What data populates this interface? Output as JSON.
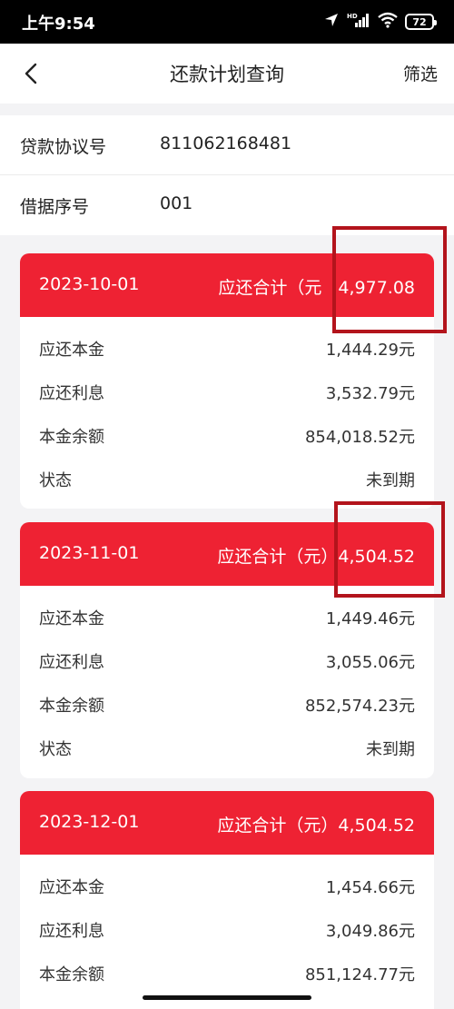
{
  "status_bar": {
    "time": "上午9:54",
    "network": "HD",
    "battery": "72"
  },
  "nav": {
    "title": "还款计划查询",
    "filter_label": "筛选",
    "back_icon": "chevron-left-icon"
  },
  "loan_info": {
    "agreement_label": "贷款协议号",
    "agreement_value": "811062168481",
    "receipt_label": "借据序号",
    "receipt_value": "001"
  },
  "plans": [
    {
      "date": "2023-10-01",
      "total_label": "应还合计（元",
      "total_value": "4,977.08",
      "rows": [
        {
          "label": "应还本金",
          "value": "1,444.29元"
        },
        {
          "label": "应还利息",
          "value": "3,532.79元"
        },
        {
          "label": "本金余额",
          "value": "854,018.52元"
        },
        {
          "label": "状态",
          "value": "未到期"
        }
      ]
    },
    {
      "date": "2023-11-01",
      "total_label": "应还合计（元）",
      "total_value": "4,504.52",
      "rows": [
        {
          "label": "应还本金",
          "value": "1,449.46元"
        },
        {
          "label": "应还利息",
          "value": "3,055.06元"
        },
        {
          "label": "本金余额",
          "value": "852,574.23元"
        },
        {
          "label": "状态",
          "value": "未到期"
        }
      ]
    },
    {
      "date": "2023-12-01",
      "total_label": "应还合计（元）",
      "total_value": "4,504.52",
      "rows": [
        {
          "label": "应还本金",
          "value": "1,454.66元"
        },
        {
          "label": "应还利息",
          "value": "3,049.86元"
        },
        {
          "label": "本金余额",
          "value": "851,124.77元"
        }
      ]
    }
  ],
  "colors": {
    "accent": "#ee2233",
    "highlight": "#b3141c",
    "background": "#f3f3f5"
  }
}
